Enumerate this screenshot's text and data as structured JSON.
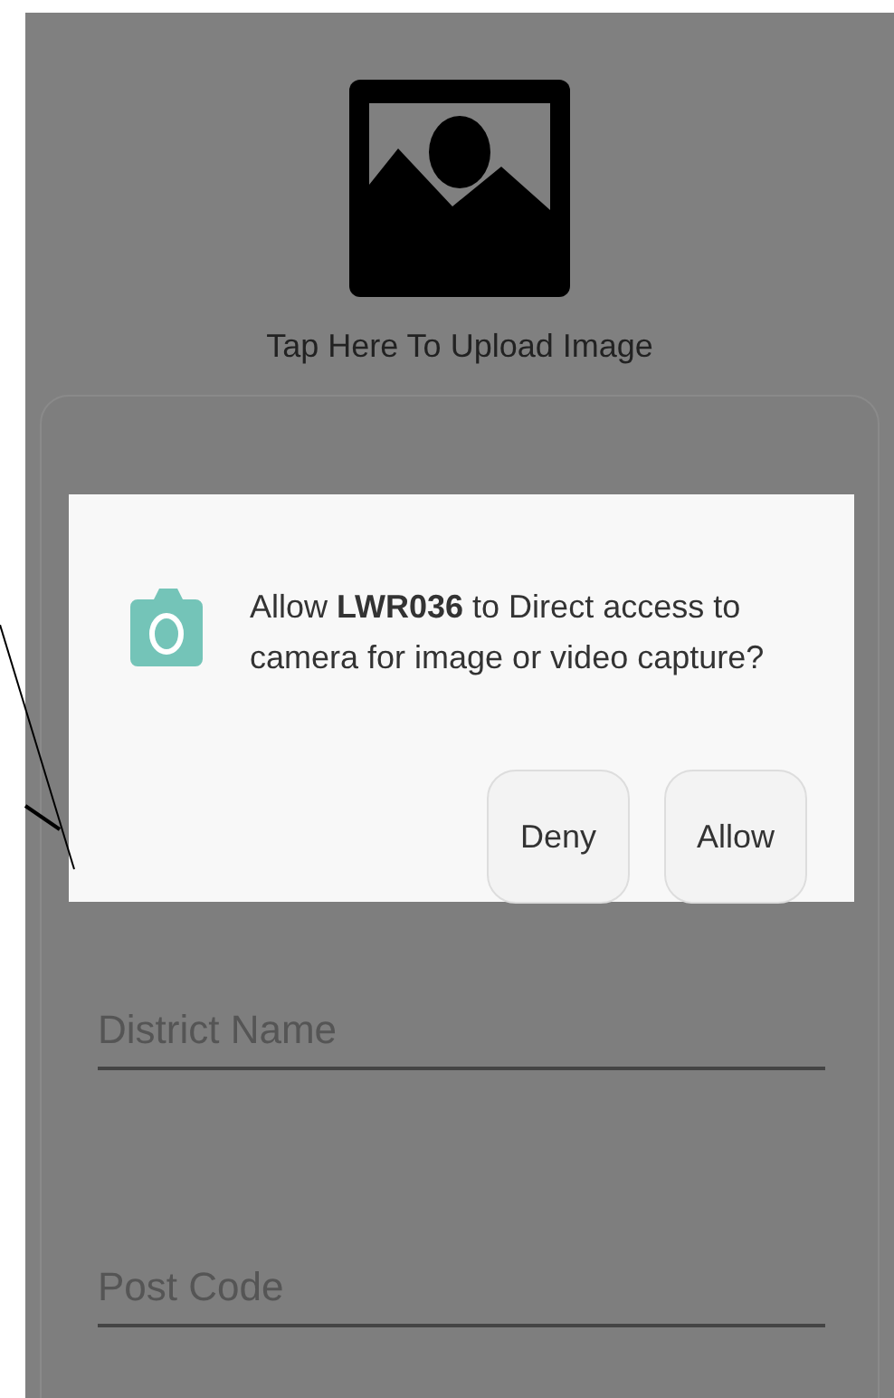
{
  "upload": {
    "label": "Tap Here To Upload Image"
  },
  "dialog": {
    "message": "Allow **LWR036** to Direct access to camera for image or video capture?",
    "buttons": [
      {
        "label": "Deny"
      },
      {
        "label": "Allow"
      }
    ]
  },
  "fields": [
    {
      "placeholder": "District Name"
    },
    {
      "placeholder": "Post Code"
    }
  ]
}
